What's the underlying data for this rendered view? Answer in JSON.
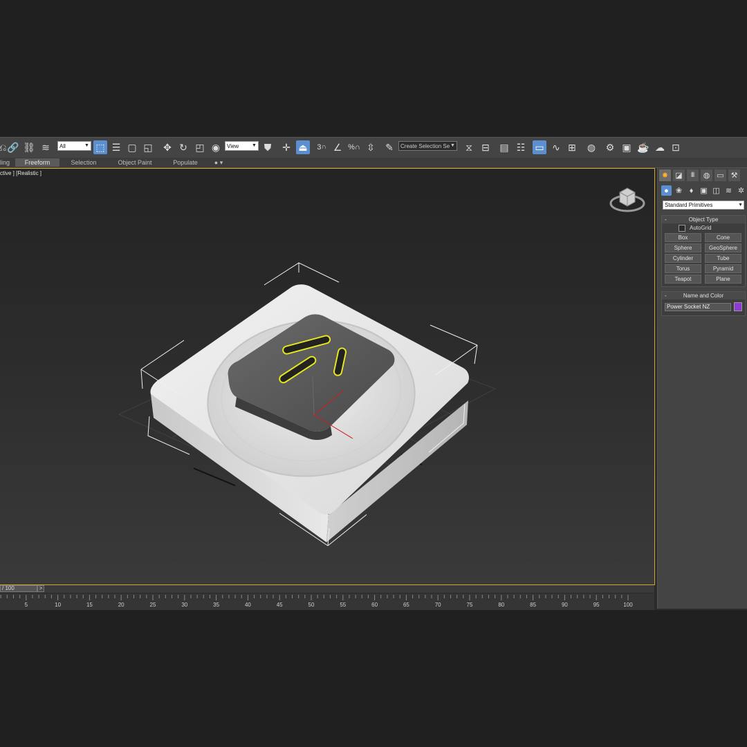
{
  "toolbar": {
    "selection_filter": "All",
    "ref_coord_system": "View",
    "snap_angle_label": "3",
    "named_selection_placeholder": "Create Selection Se"
  },
  "ribbon": {
    "tabs": [
      {
        "label": "ling"
      },
      {
        "label": "Freeform",
        "active": true
      },
      {
        "label": "Selection"
      },
      {
        "label": "Object Paint"
      },
      {
        "label": "Populate"
      }
    ]
  },
  "viewport": {
    "label": "ctive ] [Realistic ]"
  },
  "command_panel": {
    "category": "Standard Primitives",
    "object_type": {
      "title": "Object Type",
      "autogrid": "AutoGrid",
      "buttons": [
        "Box",
        "Cone",
        "Sphere",
        "GeoSphere",
        "Cylinder",
        "Tube",
        "Torus",
        "Pyramid",
        "Teapot",
        "Plane"
      ]
    },
    "name_and_color": {
      "title": "Name and Color",
      "name": "Power Socket NZ",
      "color": "#8e3bd6"
    }
  },
  "timeline": {
    "frame": "/ 100",
    "next": ">",
    "ticks": [
      "5",
      "10",
      "15",
      "20",
      "25",
      "30",
      "35",
      "40",
      "45",
      "50",
      "55",
      "60",
      "65",
      "70",
      "75",
      "80",
      "85",
      "90",
      "95",
      "100"
    ]
  },
  "colors": {
    "viewport_border": "#d7a52c",
    "accent": "#5b8fcf",
    "pin_highlight": "#e6e61e"
  }
}
